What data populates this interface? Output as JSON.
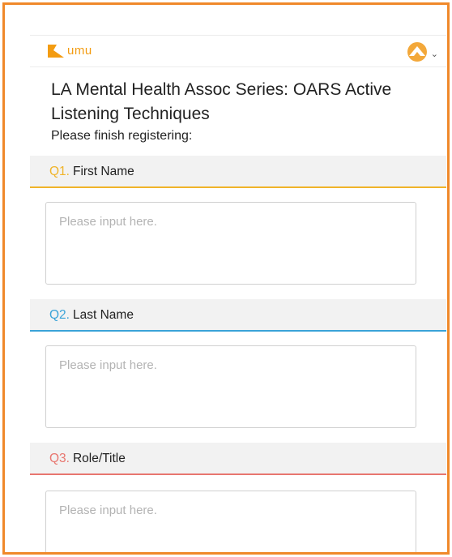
{
  "app": {
    "logo_text": "umu"
  },
  "page": {
    "title": "LA Mental Health Assoc Series: OARS Active Listening Techniques",
    "subtitle": "Please finish registering:"
  },
  "questions": [
    {
      "num": "Q1.",
      "label": "First Name",
      "color": "#f0b429",
      "placeholder": "Please input here."
    },
    {
      "num": "Q2.",
      "label": "Last Name",
      "color": "#3aa3d8",
      "placeholder": "Please input here."
    },
    {
      "num": "Q3.",
      "label": "Role/Title",
      "color": "#e8766f",
      "placeholder": "Please input here."
    }
  ],
  "colors": {
    "frame": "#f0892a",
    "brand": "#f39c12"
  },
  "icons": {
    "logo": "umu-logo-icon",
    "account": "account-avatar-icon",
    "menu": "chevron-down-icon"
  }
}
